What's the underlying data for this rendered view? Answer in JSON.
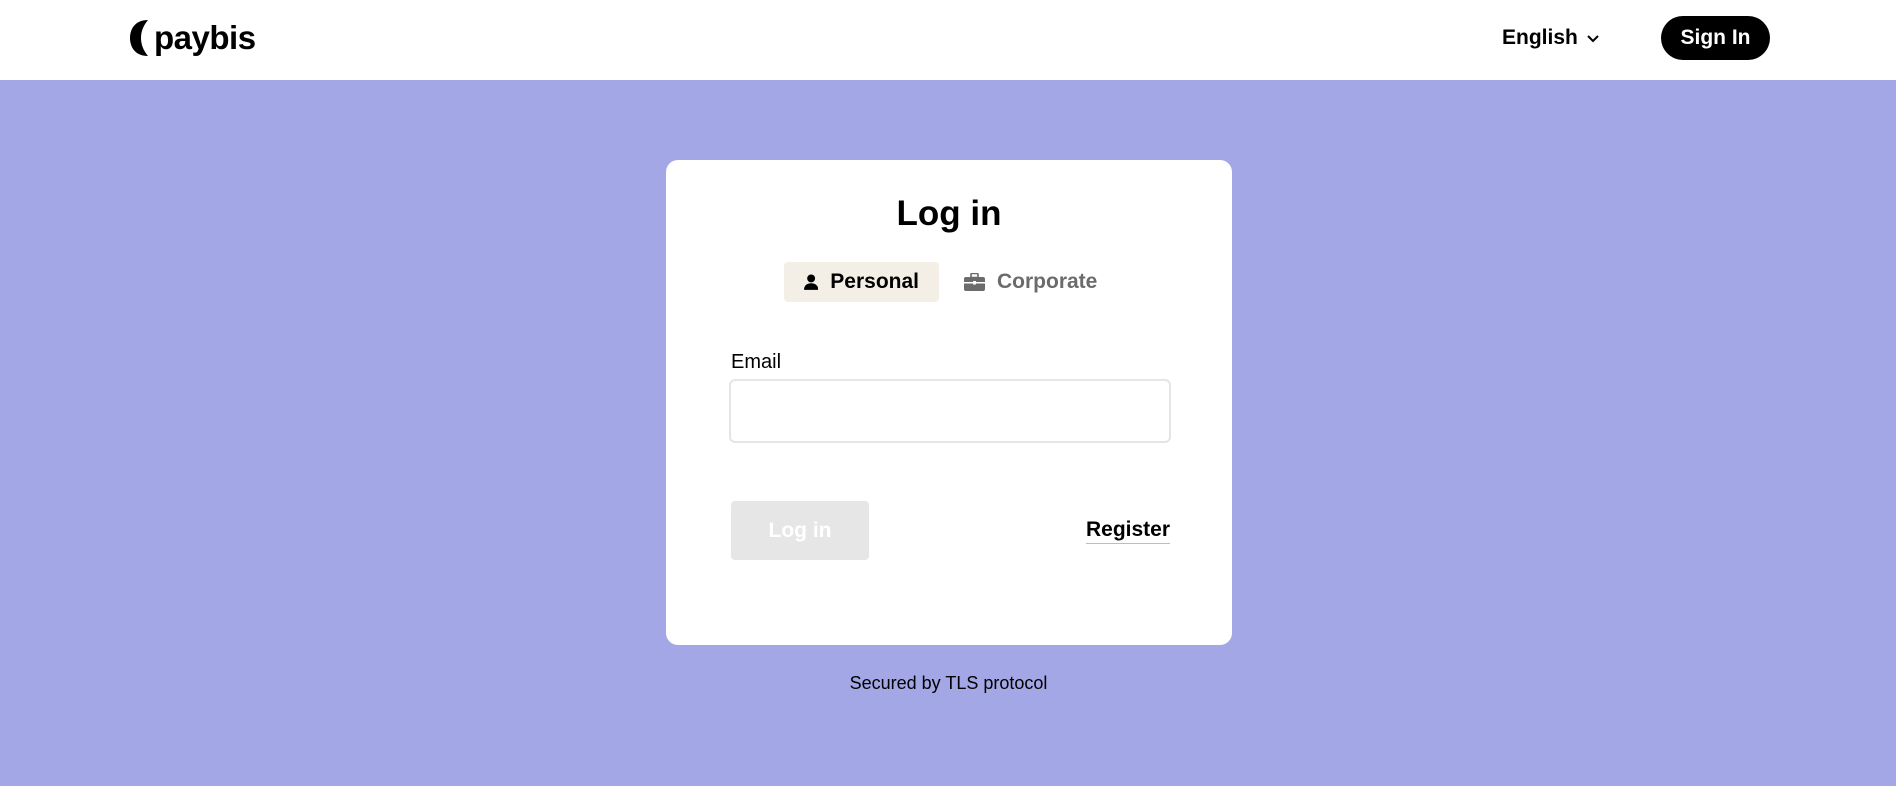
{
  "header": {
    "logo_text": "paybis",
    "language": "English",
    "signin_label": "Sign In"
  },
  "card": {
    "title": "Log in",
    "tabs": [
      {
        "label": "Personal",
        "icon": "user-icon",
        "active": true
      },
      {
        "label": "Corporate",
        "icon": "briefcase-icon",
        "active": false
      }
    ],
    "email_label": "Email",
    "email_value": "",
    "email_placeholder": "",
    "login_label": "Log in",
    "register_label": "Register"
  },
  "footer": {
    "secured_text": "Secured by TLS protocol"
  },
  "colors": {
    "background": "#a4a7e5",
    "primary": "#000000",
    "disabled_button": "#e6e6e6",
    "active_tab": "#f3efe6"
  }
}
